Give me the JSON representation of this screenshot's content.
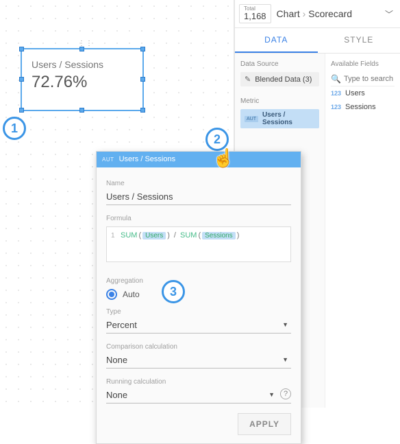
{
  "header": {
    "total_label": "Total",
    "total_value": "1,168",
    "crumb1": "Chart",
    "crumb2": "Scorecard"
  },
  "tabs": {
    "data": "DATA",
    "style": "STYLE"
  },
  "datasource": {
    "label": "Data Source",
    "name": "Blended Data (3)"
  },
  "metric": {
    "label": "Metric",
    "aut": "AUT",
    "name": "Users / Sessions"
  },
  "fields": {
    "label": "Available Fields",
    "search_ph": "Type to search",
    "items": [
      "Users",
      "Sessions"
    ]
  },
  "scorecard": {
    "label": "Users / Sessions",
    "value": "72.76%"
  },
  "badge1": "1",
  "badge2": "2",
  "badge3": "3",
  "popup": {
    "aut": "AUT",
    "title": "Users / Sessions",
    "name_lbl": "Name",
    "name_val": "Users / Sessions",
    "formula_lbl": "Formula",
    "line_no": "1",
    "fn_sum": "SUM",
    "chip_users": "Users",
    "chip_sessions": "Sessions",
    "open": "(",
    "close": ")",
    "slash": "/",
    "agg_lbl": "Aggregation",
    "agg_val": "Auto",
    "type_lbl": "Type",
    "type_val": "Percent",
    "comp_lbl": "Comparison calculation",
    "comp_val": "None",
    "run_lbl": "Running calculation",
    "run_val": "None",
    "help": "?",
    "apply": "APPLY"
  }
}
